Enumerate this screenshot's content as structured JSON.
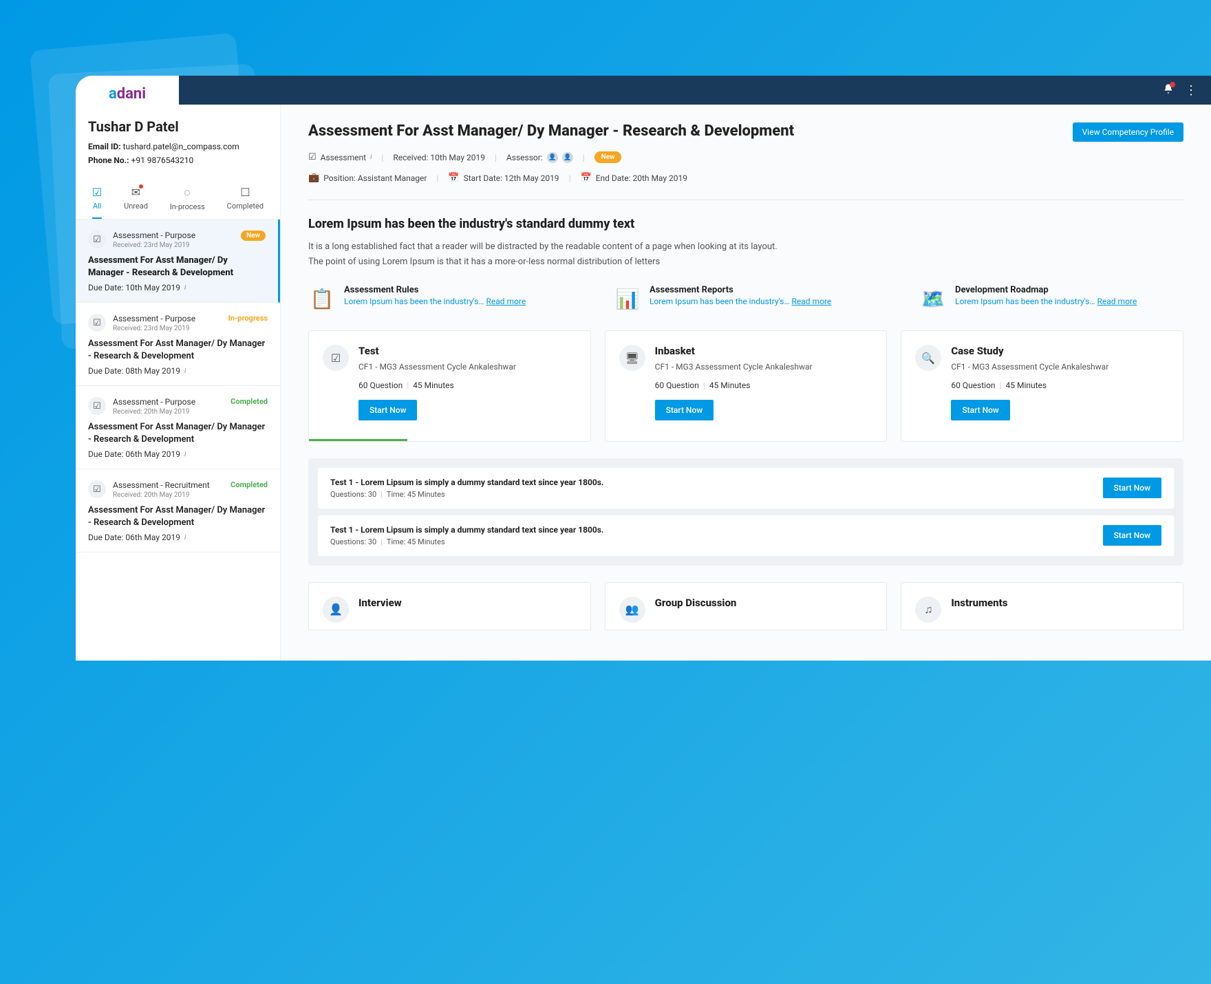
{
  "logo": {
    "a": "a",
    "dani": "dani"
  },
  "user": {
    "name": "Tushar D Patel",
    "email_label": "Email ID:",
    "email": "tushard.patel@n_compass.com",
    "phone_label": "Phone No.:",
    "phone": "+91 9876543210"
  },
  "tabs": {
    "all": "All",
    "unread": "Unread",
    "inprocess": "In-process",
    "completed": "Completed"
  },
  "list": [
    {
      "type": "Assessment - Purpose",
      "received": "Received: 23rd May 2019",
      "badge": "New",
      "status": "",
      "title": "Assessment For Asst Manager/ Dy Manager - Research & Development",
      "due": "Due Date: 10th May 2019"
    },
    {
      "type": "Assessment - Purpose",
      "received": "Received: 23rd May 2019",
      "badge": "",
      "status": "In-progress",
      "title": "Assessment For Asst Manager/ Dy Manager - Research & Development",
      "due": "Due Date: 08th May 2019"
    },
    {
      "type": "Assessment - Purpose",
      "received": "Received: 20th May 2019",
      "badge": "",
      "status": "Completed",
      "title": "Assessment For Asst Manager/ Dy Manager - Research & Development",
      "due": "Due Date: 06th May 2019"
    },
    {
      "type": "Assessment - Recruitment",
      "received": "Received: 20th May 2019",
      "badge": "",
      "status": "Completed",
      "title": "Assessment For Asst Manager/ Dy Manager - Research & Development",
      "due": "Due Date: 06th May 2019"
    }
  ],
  "main": {
    "title": "Assessment For Asst Manager/ Dy Manager - Research & Development",
    "btn_profile": "View Competency Profile",
    "assessment_label": "Assessment",
    "received": "Received: 10th May 2019",
    "assessor_label": "Assessor:",
    "new_badge": "New",
    "position": "Position: Assistant Manager",
    "start_date": "Start Date: 12th May 2019",
    "end_date": "End Date: 20th May 2019",
    "section_title": "Lorem Ipsum has been the industry's standard dummy text",
    "section_desc1": "It is a long established fact that a reader will be distracted by the readable content of a page when looking at its layout.",
    "section_desc2": "The point of using Lorem Ipsum is that it has a more-or-less normal distribution of letters"
  },
  "docs": [
    {
      "title": "Assessment Rules",
      "desc": "Lorem Ipsum has been the industry's…",
      "more": "Read more"
    },
    {
      "title": "Assessment Reports",
      "desc": "Lorem Ipsum has been the industry's…",
      "more": "Read more"
    },
    {
      "title": "Development Roadmap",
      "desc": "Lorem Ipsum has been the industry's…",
      "more": "Read more"
    }
  ],
  "cards": [
    {
      "title": "Test",
      "sub": "CF1 - MG3 Assessment Cycle Ankaleshwar",
      "q": "60 Question",
      "t": "45 Minutes",
      "btn": "Start Now"
    },
    {
      "title": "Inbasket",
      "sub": "CF1 - MG3 Assessment Cycle Ankaleshwar",
      "q": "60 Question",
      "t": "45 Minutes",
      "btn": "Start Now"
    },
    {
      "title": "Case Study",
      "sub": "CF1 - MG3 Assessment Cycle Ankaleshwar",
      "q": "60 Question",
      "t": "45 Minutes",
      "btn": "Start Now"
    }
  ],
  "tests": [
    {
      "title": "Test 1 - Lorem Lipsum is simply a dummy standard text since year 1800s.",
      "q": "Questions: 30",
      "t": "Time: 45 Minutes",
      "btn": "Start Now"
    },
    {
      "title": "Test 1 - Lorem Lipsum is simply a dummy standard text since year 1800s.",
      "q": "Questions: 30",
      "t": "Time: 45 Minutes",
      "btn": "Start Now"
    }
  ],
  "cards2": [
    {
      "title": "Interview"
    },
    {
      "title": "Group Discussion"
    },
    {
      "title": "Instruments"
    }
  ]
}
